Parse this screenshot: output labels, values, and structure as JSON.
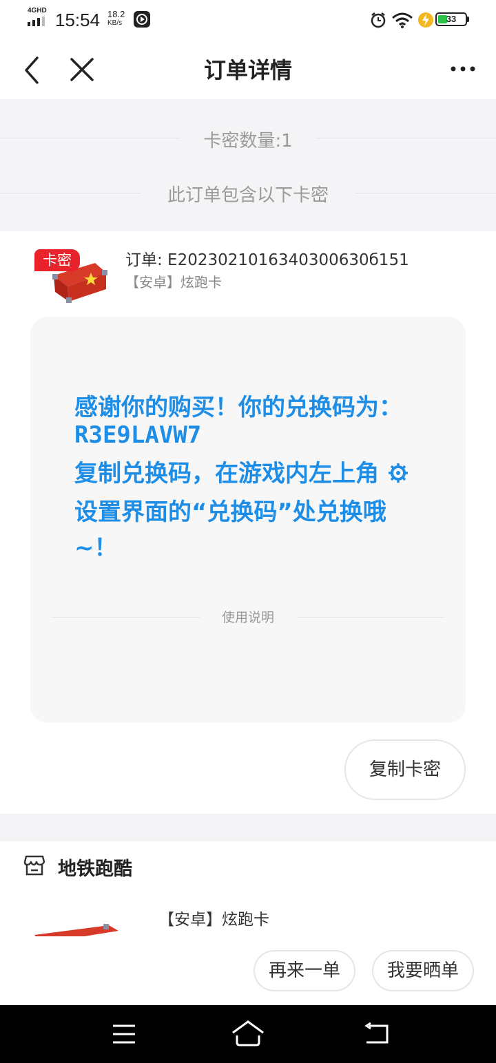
{
  "status_bar": {
    "network": "4GHD",
    "time": "15:54",
    "speed_value": "18.2",
    "speed_unit": "KB/s",
    "battery": "33",
    "icons": [
      "signal-icon",
      "media-icon",
      "alarm-icon",
      "wifi-icon",
      "charging-icon",
      "battery-icon"
    ]
  },
  "nav": {
    "title": "订单详情"
  },
  "summary": {
    "card_count": "卡密数量:1",
    "card_contains": "此订单包含以下卡密"
  },
  "card": {
    "badge": "卡密",
    "order_label": "订单: E2023021016340300630б151",
    "product": "【安卓】炫跑卡",
    "message_lines": [
      "感谢你的购买！你的兑换码为：",
      "R3E9LAVW7",
      "复制兑换码，在游戏内左上角",
      "设置界面的“兑换码”处兑换哦",
      "~！"
    ],
    "usage_label": "使用说明",
    "copy_button": "复制卡密"
  },
  "store": {
    "name": "地铁跑酷",
    "product": "【安卓】炫跑卡"
  },
  "actions": {
    "reorder": "再来一单",
    "share": "我要晒单"
  },
  "colors": {
    "accent_blue": "#1e8de6",
    "badge_red": "#e8232b"
  }
}
